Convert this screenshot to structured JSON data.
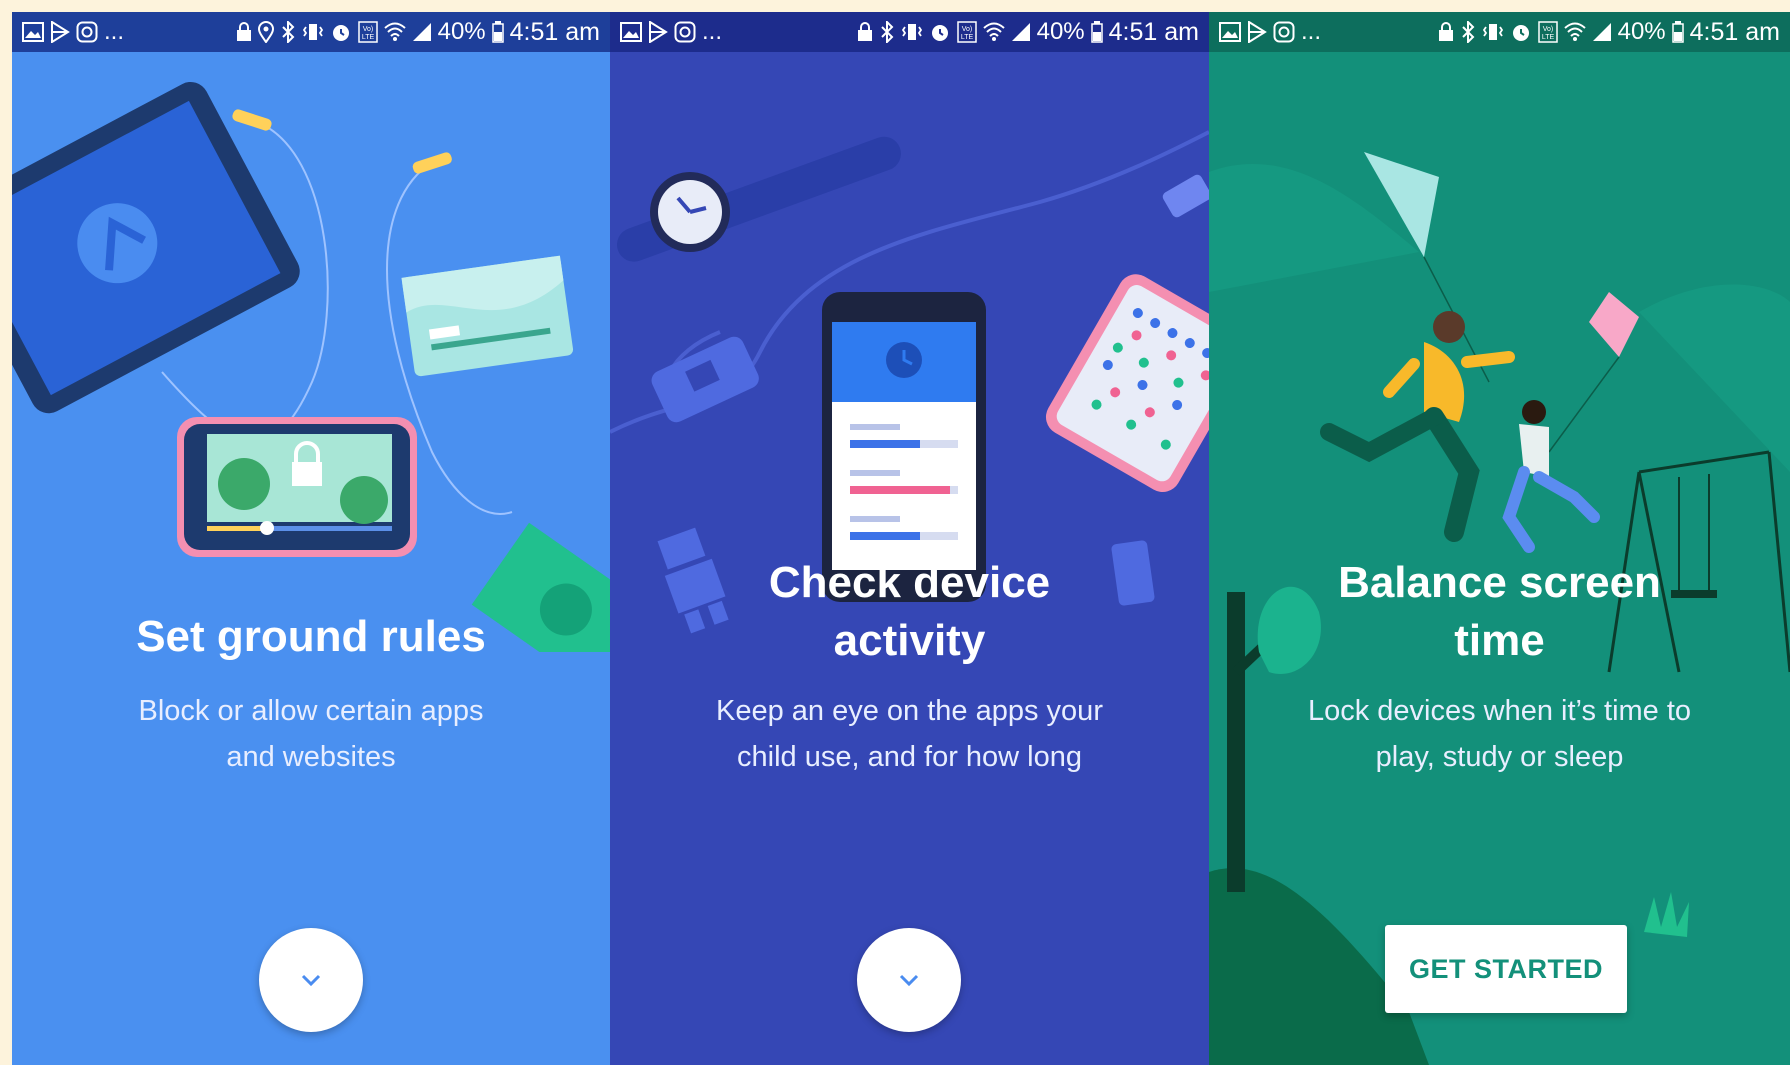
{
  "status_bar": {
    "notification_icons": [
      "gallery-icon",
      "play-store-icon",
      "instagram-icon"
    ],
    "overflow": "...",
    "volte": "Vo) LTE",
    "battery": "40%",
    "time": "4:51 am"
  },
  "screens": [
    {
      "title": "Set ground rules",
      "description_line1": "Block or allow certain apps",
      "description_line2": "and websites",
      "action_icon": "chevron-down-icon"
    },
    {
      "title_line1": "Check device",
      "title_line2": "activity",
      "description_line1": "Keep an eye on the apps your",
      "description_line2": "child use, and for how long",
      "action_icon": "chevron-down-icon"
    },
    {
      "title_line1": "Balance screen",
      "title_line2": "time",
      "description_line1": "Lock devices when it’s time to",
      "description_line2": "play, study or sleep",
      "cta_label": "GET STARTED"
    }
  ],
  "colors": {
    "screen1_bg": "#4a90f0",
    "screen2_bg": "#3547b5",
    "screen3_bg": "#13907a",
    "accent_button_text": "#13907a",
    "chevron": "#4a8cf0"
  }
}
